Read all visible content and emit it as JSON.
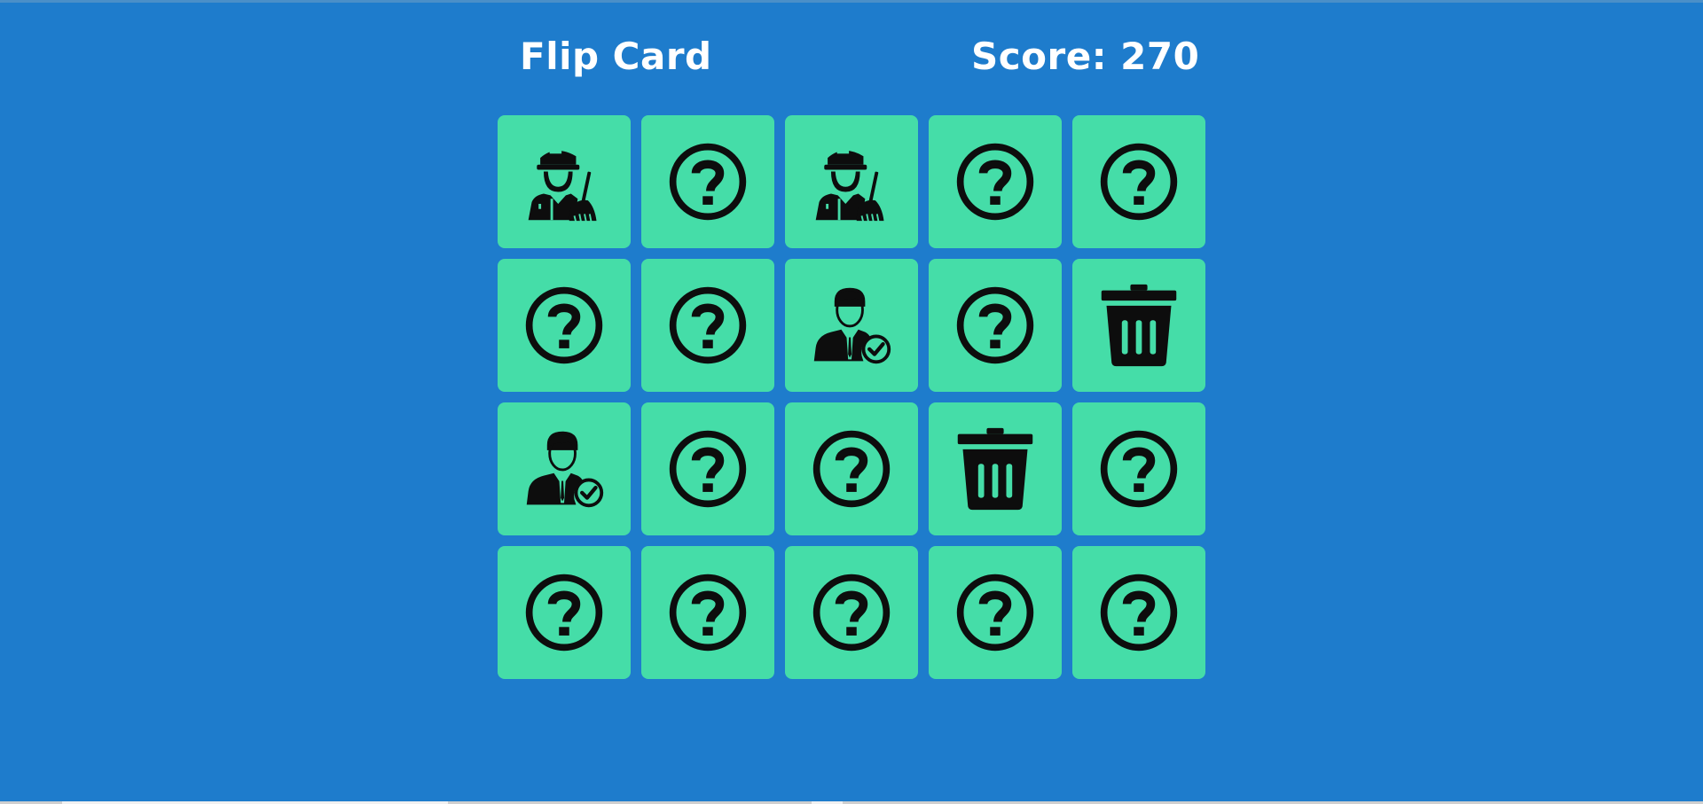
{
  "header": {
    "title": "Flip Card",
    "score_text": "Score: 270"
  },
  "colors": {
    "background": "#1e7ccc",
    "card": "#45dda8",
    "icon": "#0d0d0d",
    "text": "#ffffff"
  },
  "board": {
    "rows": 4,
    "columns": 5,
    "cards": [
      {
        "icon": "janitor-icon",
        "state": "revealed"
      },
      {
        "icon": "question-icon",
        "state": "hidden"
      },
      {
        "icon": "janitor-icon",
        "state": "revealed"
      },
      {
        "icon": "question-icon",
        "state": "hidden"
      },
      {
        "icon": "question-icon",
        "state": "hidden"
      },
      {
        "icon": "question-icon",
        "state": "hidden"
      },
      {
        "icon": "question-icon",
        "state": "hidden"
      },
      {
        "icon": "approved-user-icon",
        "state": "revealed"
      },
      {
        "icon": "question-icon",
        "state": "hidden"
      },
      {
        "icon": "trash-icon",
        "state": "revealed"
      },
      {
        "icon": "approved-user-icon",
        "state": "revealed"
      },
      {
        "icon": "question-icon",
        "state": "hidden"
      },
      {
        "icon": "question-icon",
        "state": "hidden"
      },
      {
        "icon": "trash-icon",
        "state": "revealed"
      },
      {
        "icon": "question-icon",
        "state": "hidden"
      },
      {
        "icon": "question-icon",
        "state": "hidden"
      },
      {
        "icon": "question-icon",
        "state": "hidden"
      },
      {
        "icon": "question-icon",
        "state": "hidden"
      },
      {
        "icon": "question-icon",
        "state": "hidden"
      },
      {
        "icon": "question-icon",
        "state": "hidden"
      }
    ]
  }
}
